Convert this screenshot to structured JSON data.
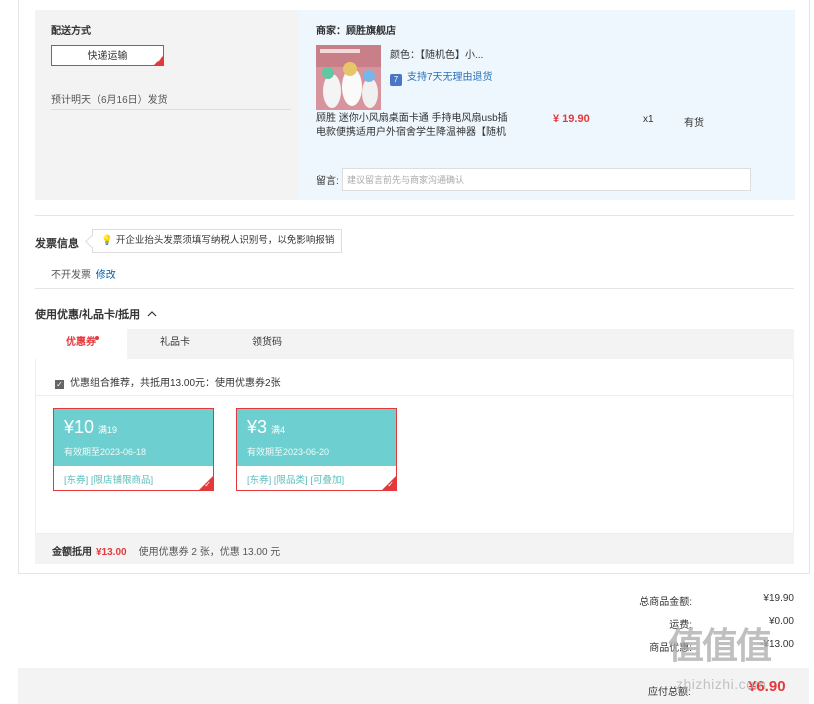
{
  "shipping": {
    "title": "配送方式",
    "method": "快递运输",
    "estimate": "预计明天（6月16日）发货"
  },
  "shop": {
    "merchant": "商家：顾胜旗舰店",
    "product": {
      "color": "颜色：【随机色】小...",
      "return_policy": "支持7天无理由退货",
      "name": "顾胜 迷你小风扇桌面卡通 手持电风扇usb插电款便携适用户外宿舍学生降温神器【随机",
      "price": "¥ 19.90",
      "qty": "x1",
      "stock": "有货"
    },
    "message_label": "留言:",
    "message_placeholder": "建议留言前先与商家沟通确认"
  },
  "invoice": {
    "title": "发票信息",
    "tip": "开企业抬头发票须填写纳税人识别号，以免影响报销",
    "status": "不开发票",
    "edit": "修改"
  },
  "coupons": {
    "section_title": "使用优惠/礼品卡/抵用",
    "tabs": [
      {
        "label": "优惠券",
        "active": true
      },
      {
        "label": "礼品卡",
        "active": false
      },
      {
        "label": "领货码",
        "active": false
      }
    ],
    "combo_text": "优惠组合推荐，共抵用13.00元：使用优惠券2张",
    "items": [
      {
        "amount": "¥10",
        "condition": "满19",
        "valid": "有效期至2023-06-18",
        "tags": "[东券]  [限店铺限商品]"
      },
      {
        "amount": "¥3",
        "condition": "满4",
        "valid": "有效期至2023-06-20",
        "tags": "[东券]  [限品类]  [可叠加]"
      }
    ],
    "summary_label": "金额抵用",
    "summary_amount": "¥13.00",
    "summary_desc": "使用优惠券 2 张，优惠 13.00 元"
  },
  "totals": [
    {
      "label": "总商品金额:",
      "value": "¥19.90"
    },
    {
      "label": "运费:",
      "value": "¥0.00"
    },
    {
      "label": "商品优惠:",
      "value": "-¥13.00"
    }
  ],
  "payable": {
    "label": "应付总额:",
    "value": "¥6.90"
  },
  "watermark": {
    "mark": "值值值",
    "url": "zhizhizhi.com"
  },
  "colors": {
    "accent": "#e4393c",
    "coupon": "#6dcfcf",
    "link": "#005ea7"
  }
}
